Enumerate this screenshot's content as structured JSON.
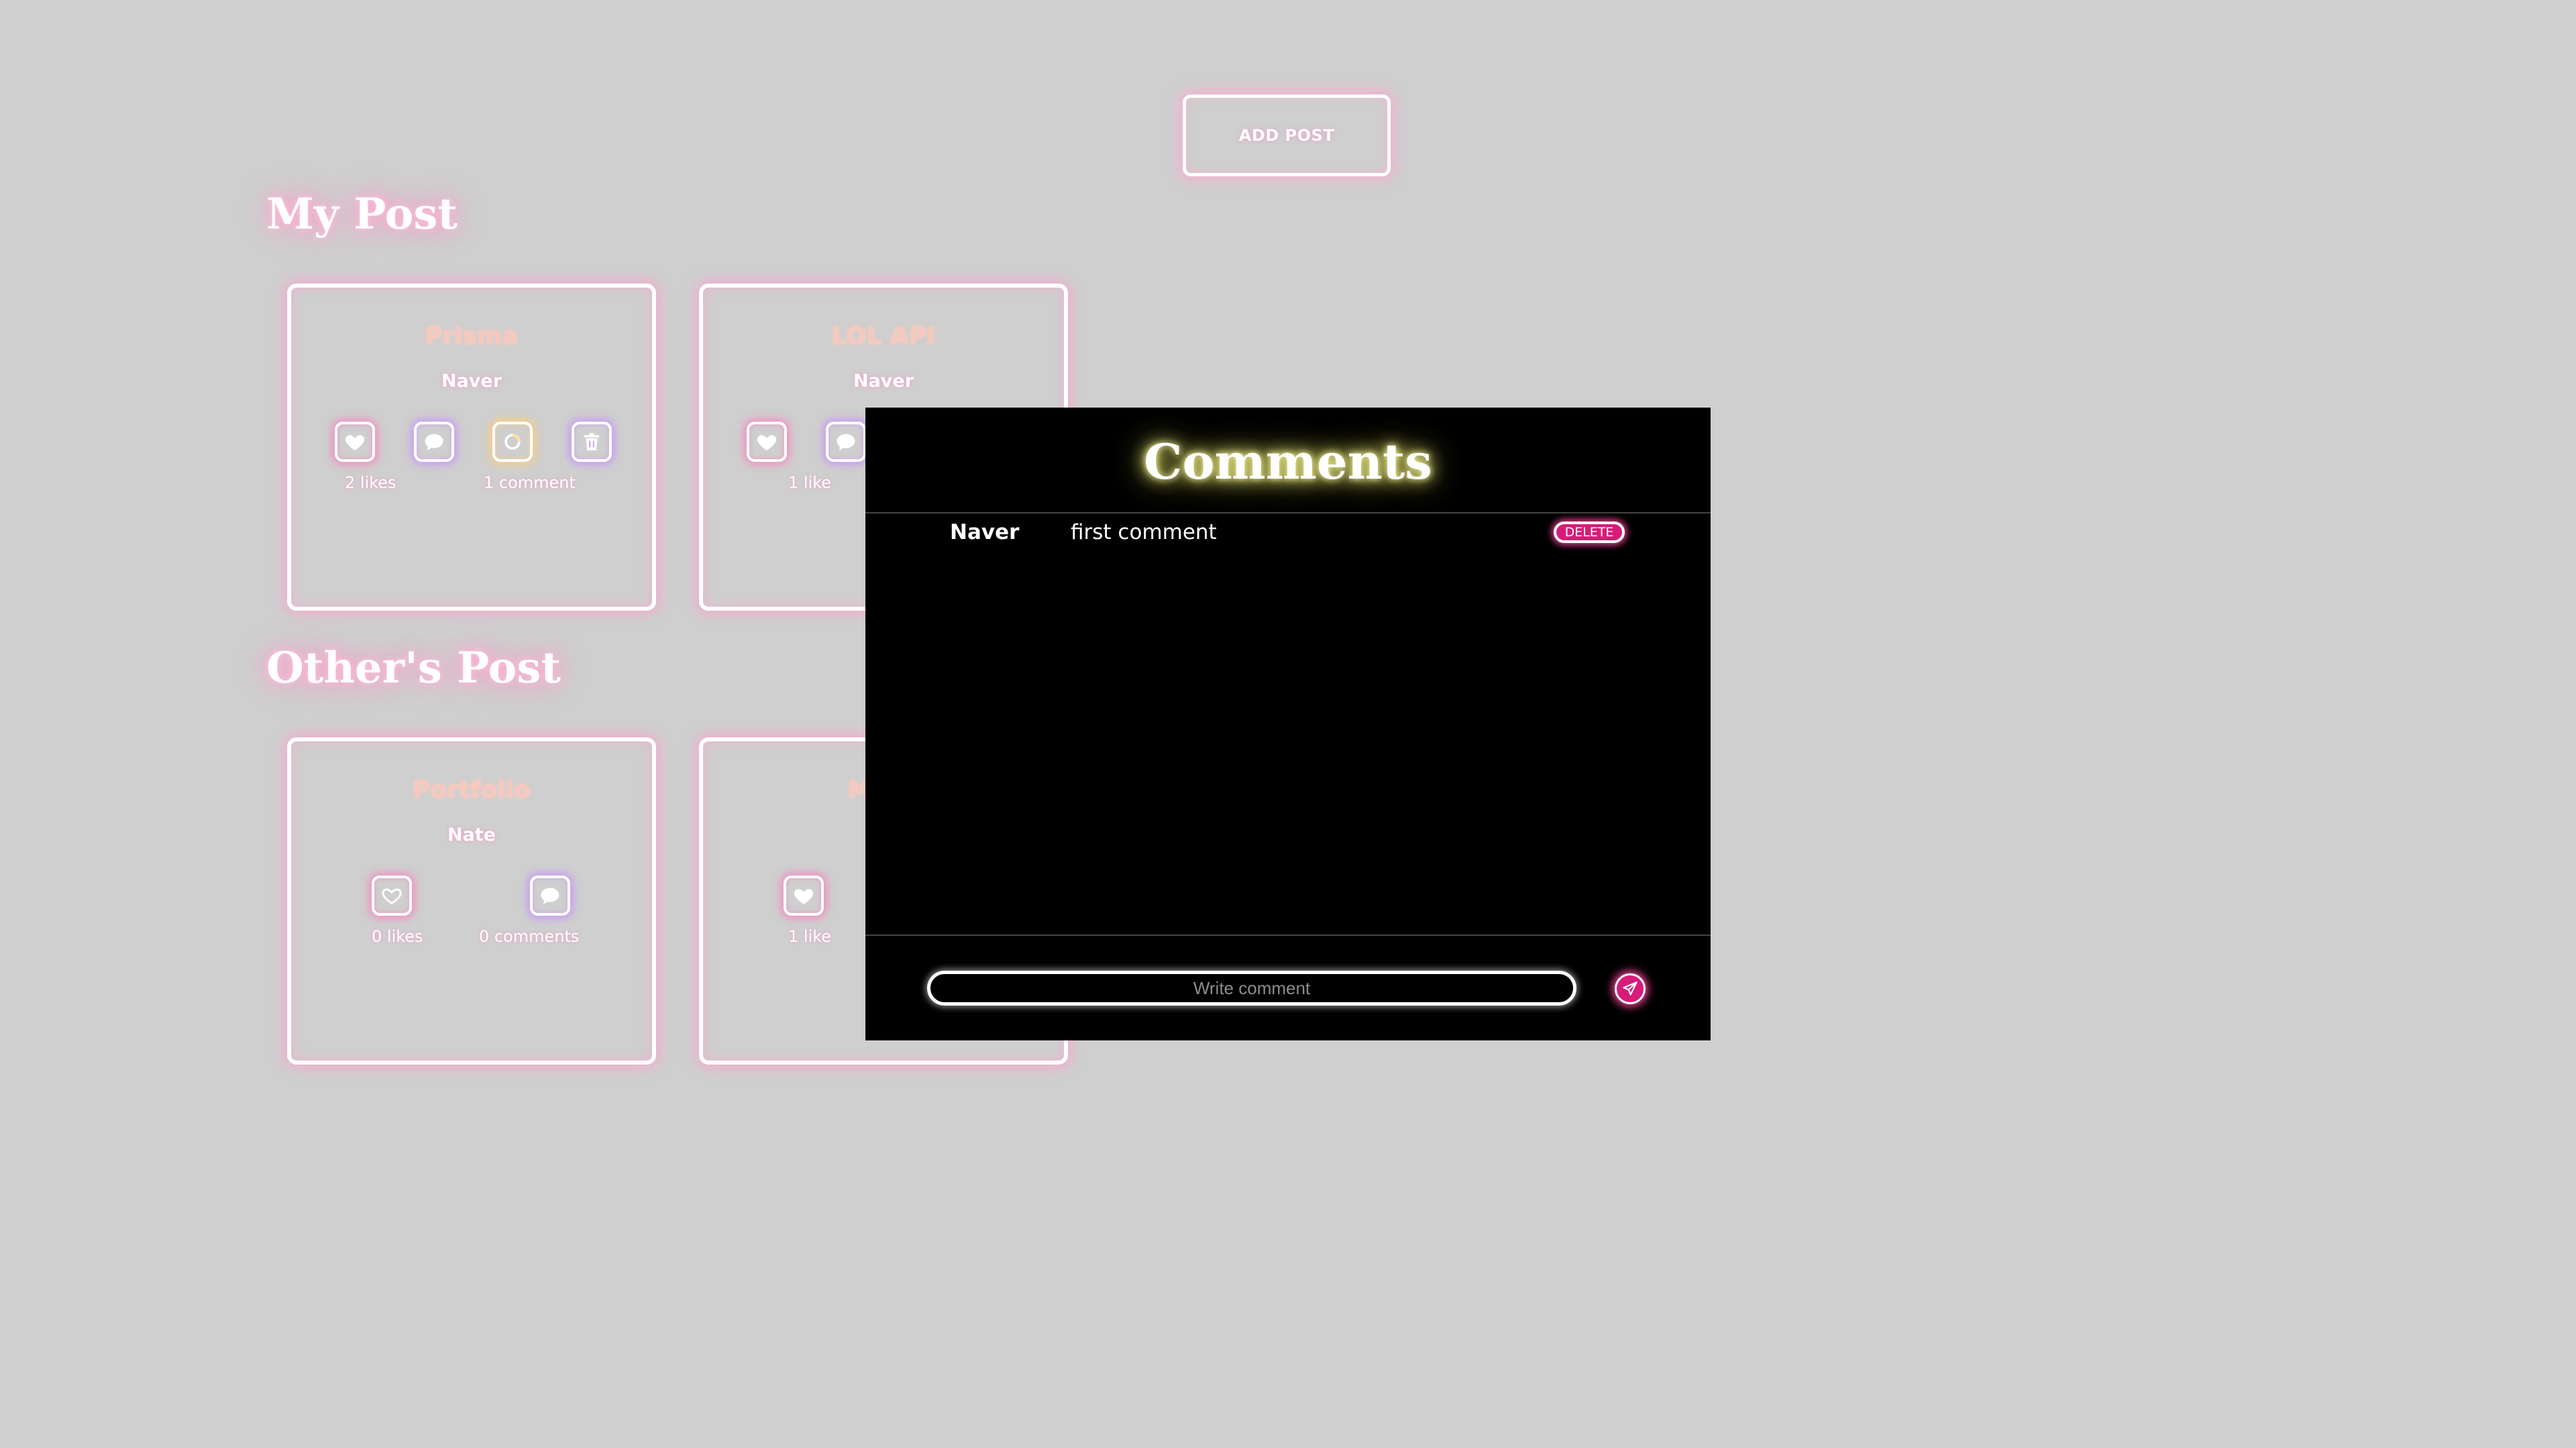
{
  "header": {
    "add_post_label": "ADD POST"
  },
  "my_posts": {
    "title": "My Post",
    "posts": [
      {
        "title": "Prisma",
        "author": "Naver",
        "likes_text": "2 likes",
        "comments_text": "1 comment",
        "liked": true
      },
      {
        "title": "LOL API",
        "author": "Naver",
        "likes_text": "1 like",
        "liked": true
      }
    ]
  },
  "other_posts": {
    "title": "Other's Post",
    "posts": [
      {
        "title": "Portfolio",
        "author": "Nate",
        "likes_text": "0 likes",
        "comments_text": "0 comments",
        "liked": false
      },
      {
        "title": "Make",
        "likes_text": "1 like",
        "liked": true
      }
    ]
  },
  "icons": [
    "heart-icon",
    "comment-icon",
    "edit-icon",
    "trash-icon",
    "send-icon"
  ],
  "colors": {
    "background": "#cfcfcf",
    "accent_pink": "#d81b78",
    "modal_bg": "#000000"
  },
  "comments_modal": {
    "title": "Comments",
    "comments": [
      {
        "author": "Naver",
        "text": "first comment",
        "delete_label": "DELETE"
      }
    ],
    "input_placeholder": "Write comment"
  }
}
